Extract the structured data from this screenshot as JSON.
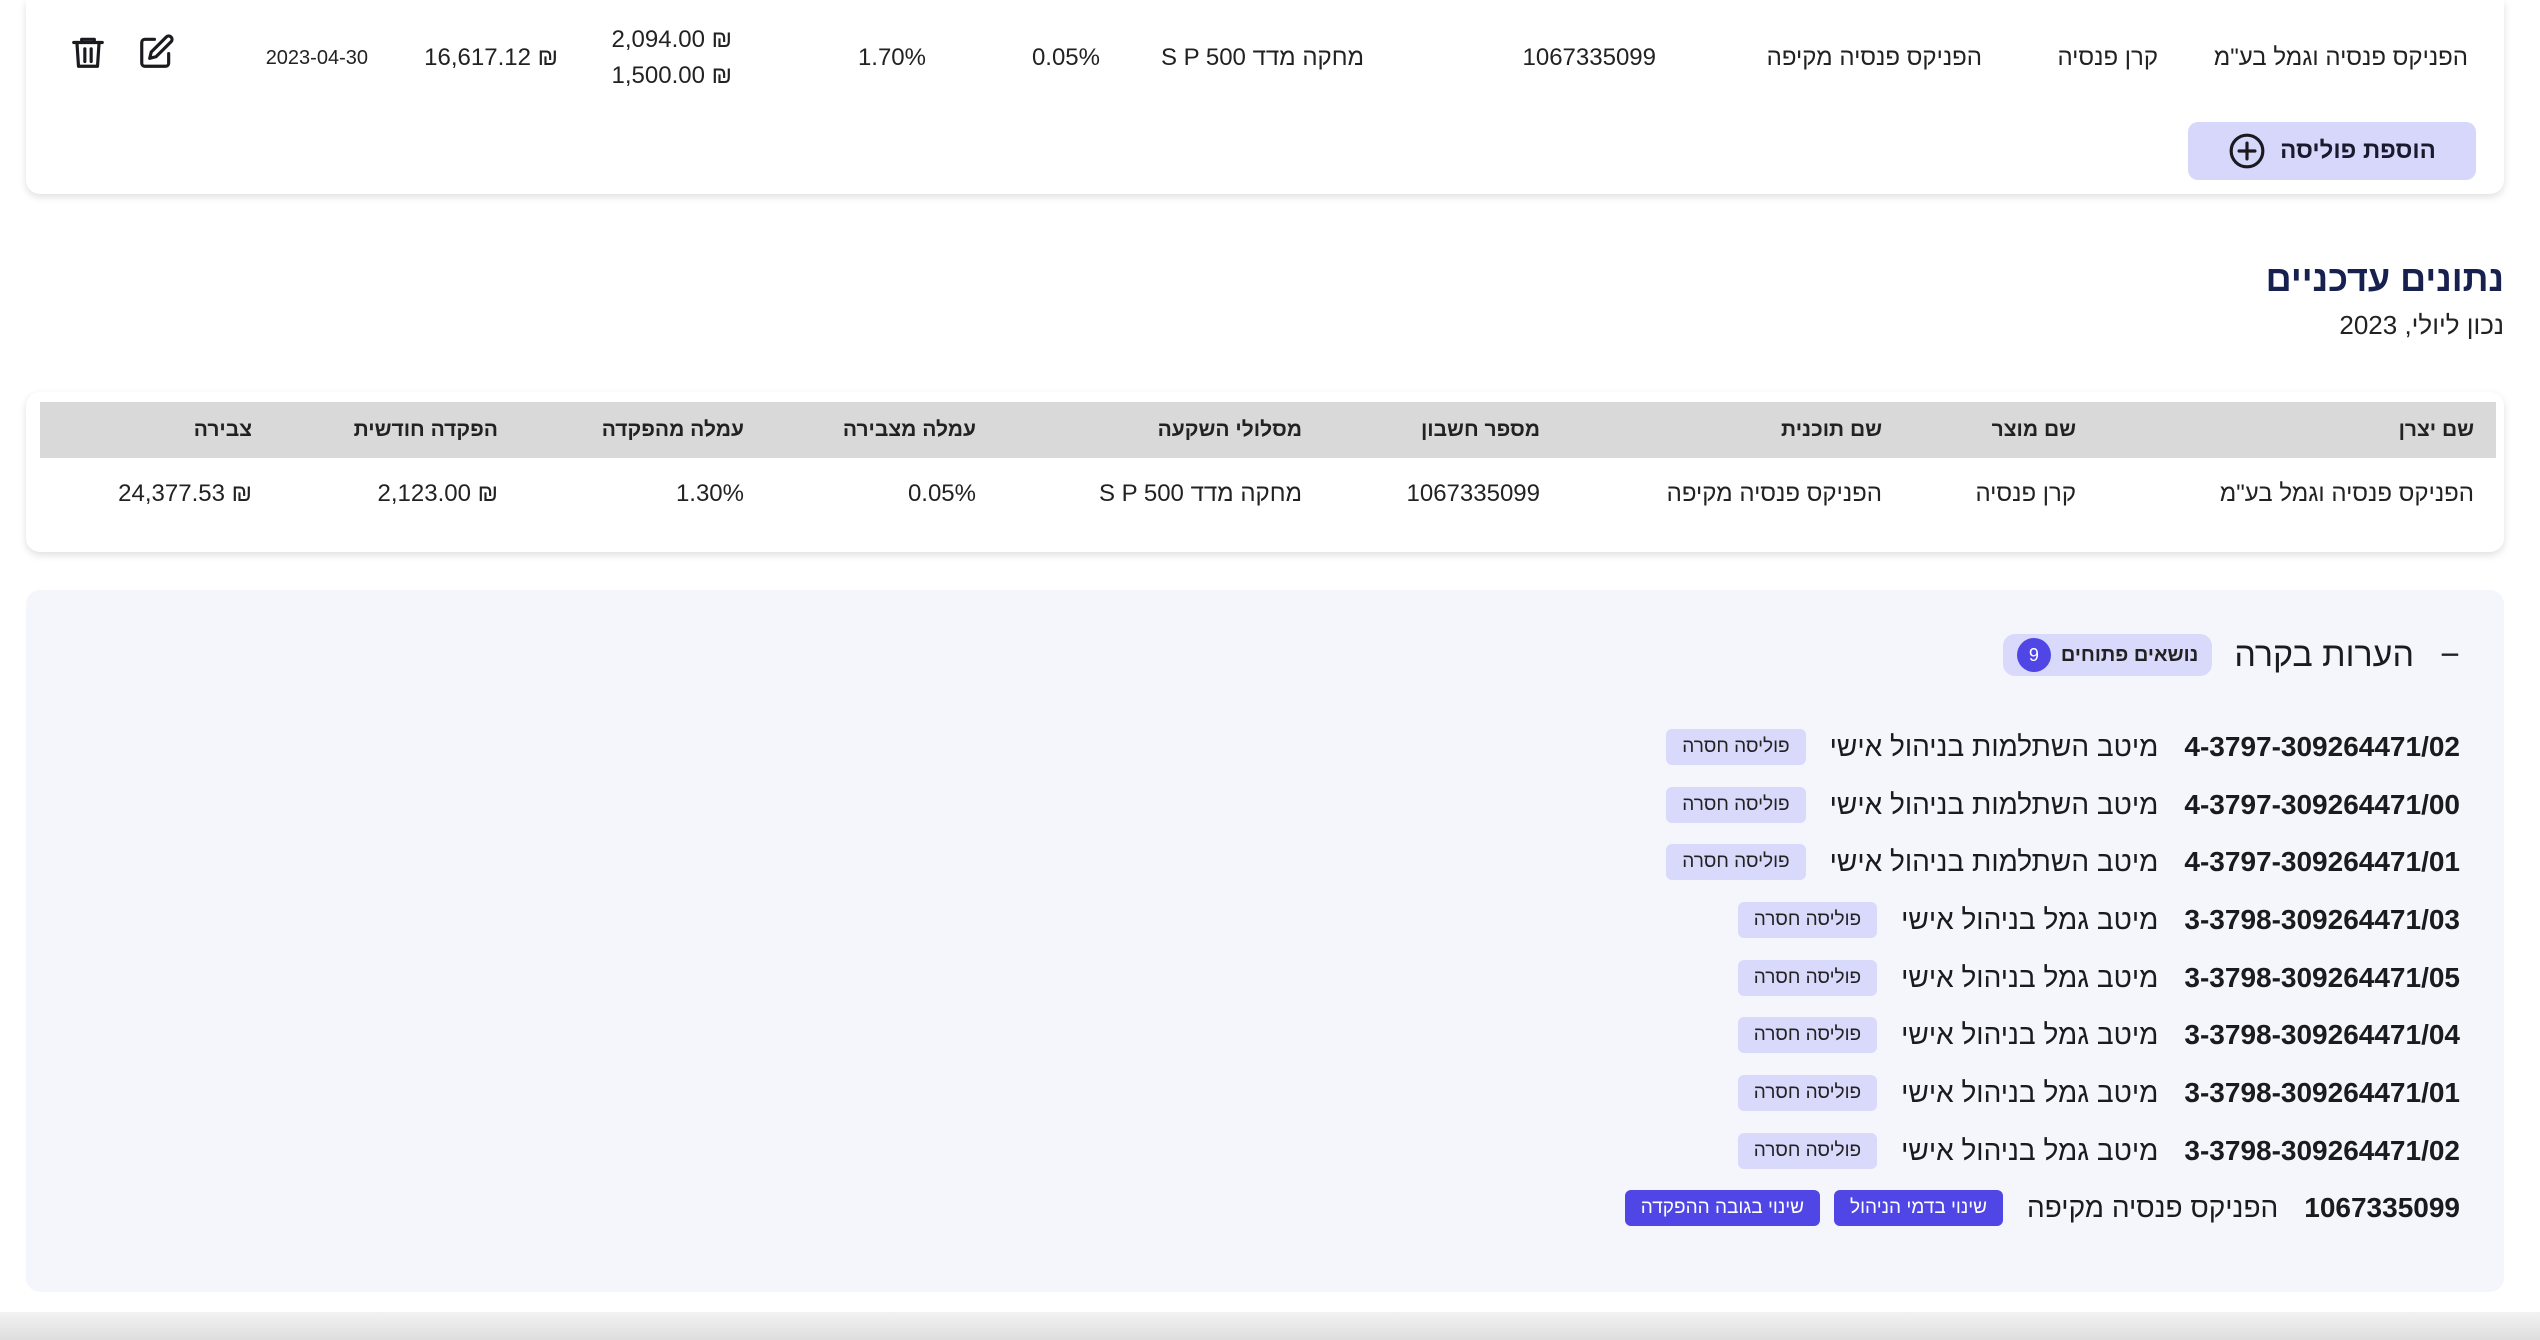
{
  "policy": {
    "manufacturer": "הפניקס פנסיה וגמל בע\"מ",
    "product": "קרן פנסיה",
    "plan": "הפניקס פנסיה מקיפה",
    "account": "1067335099",
    "track": "S P 500 מחקה מדד",
    "fee_accumulation": "0.05%",
    "fee_deposit": "1.70%",
    "deposit_line1": "2,094.00 ₪",
    "deposit_line2": "1,500.00 ₪",
    "balance": "16,617.12 ₪",
    "date": "2023-04-30",
    "add_label": "הוספת פוליסה"
  },
  "current": {
    "title": "נתונים עדכניים",
    "subtitle": "נכון ליולי, 2023",
    "headers": [
      "שם יצרן",
      "שם מוצר",
      "שם תוכנית",
      "מספר חשבון",
      "מסלולי השקעה",
      "עמלה מצבירה",
      "עמלה מהפקדה",
      "הפקדה חודשית",
      "צבירה"
    ],
    "row": [
      "הפניקס פנסיה וגמל בע\"מ",
      "קרן פנסיה",
      "הפניקס פנסיה מקיפה",
      "1067335099",
      "S P 500 מחקה מדד",
      "0.05%",
      "1.30%",
      "2,123.00 ₪",
      "24,377.53 ₪"
    ]
  },
  "notes": {
    "title": "הערות בקרה",
    "badge_label": "נושאים פתוחים",
    "badge_count": "9",
    "items": [
      {
        "id": "4-3797-309264471/02",
        "desc": "מיטב השתלמות בניהול אישי",
        "tags": [
          "פוליסה חסרה"
        ],
        "kind": "missing"
      },
      {
        "id": "4-3797-309264471/00",
        "desc": "מיטב השתלמות בניהול אישי",
        "tags": [
          "פוליסה חסרה"
        ],
        "kind": "missing"
      },
      {
        "id": "4-3797-309264471/01",
        "desc": "מיטב השתלמות בניהול אישי",
        "tags": [
          "פוליסה חסרה"
        ],
        "kind": "missing"
      },
      {
        "id": "3-3798-309264471/03",
        "desc": "מיטב גמל בניהול אישי",
        "tags": [
          "פוליסה חסרה"
        ],
        "kind": "missing"
      },
      {
        "id": "3-3798-309264471/05",
        "desc": "מיטב גמל בניהול אישי",
        "tags": [
          "פוליסה חסרה"
        ],
        "kind": "missing"
      },
      {
        "id": "3-3798-309264471/04",
        "desc": "מיטב גמל בניהול אישי",
        "tags": [
          "פוליסה חסרה"
        ],
        "kind": "missing"
      },
      {
        "id": "3-3798-309264471/01",
        "desc": "מיטב גמל בניהול אישי",
        "tags": [
          "פוליסה חסרה"
        ],
        "kind": "missing"
      },
      {
        "id": "3-3798-309264471/02",
        "desc": "מיטב גמל בניהול אישי",
        "tags": [
          "פוליסה חסרה"
        ],
        "kind": "missing"
      },
      {
        "id": "1067335099",
        "desc": "הפניקס פנסיה מקיפה",
        "tags": [
          "שינוי בדמי הניהול",
          "שינוי בגובה ההפקדה"
        ],
        "kind": "change"
      }
    ]
  },
  "icons": {
    "delete": "trash-icon",
    "edit": "pencil-icon",
    "add": "plus-circle-icon",
    "collapse": "minus-icon"
  },
  "colors": {
    "accent": "#4f46e5",
    "accent_light": "#d8d9fb",
    "title": "#17214f",
    "panel": "#f5f6fb",
    "header_bg": "#d9d9d9"
  }
}
